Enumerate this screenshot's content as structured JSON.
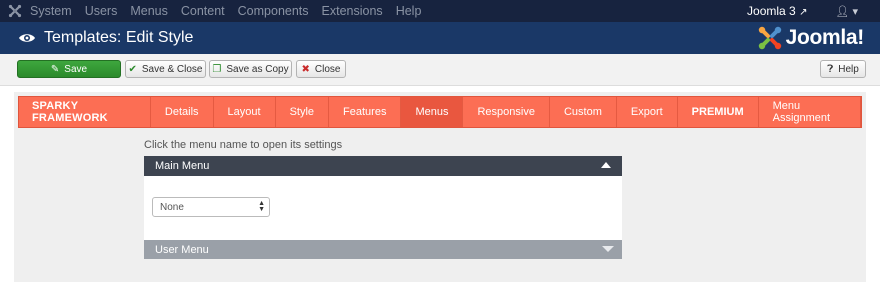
{
  "topnav": {
    "logo_icon": "joomla-icon",
    "items": [
      "System",
      "Users",
      "Menus",
      "Content",
      "Components",
      "Extensions",
      "Help"
    ],
    "site_link": "Joomla 3",
    "external_icon": "external-link-icon",
    "user_icon": "user-icon"
  },
  "header": {
    "page_icon": "eye-icon",
    "title": "Templates: Edit Style",
    "brand": "Joomla!"
  },
  "toolbar": {
    "save": "Save",
    "save_close": "Save & Close",
    "save_copy": "Save as Copy",
    "close": "Close",
    "help": "Help"
  },
  "sparky": {
    "brand": "SPARKY FRAMEWORK",
    "tabs": [
      "Details",
      "Layout",
      "Style",
      "Features",
      "Menus",
      "Responsive",
      "Custom",
      "Export",
      "PREMIUM",
      "Menu Assignment"
    ],
    "active_tab": "Menus"
  },
  "menus": {
    "hint": "Click the menu name to open its settings",
    "main_menu": "Main Menu",
    "main_menu_select": "None",
    "user_menu": "User Menu"
  },
  "colors": {
    "topnav_bg": "#17233f",
    "header_bg": "#1a3867",
    "sparky_bg": "#fc6e54",
    "save_green": "#2f8f2f"
  }
}
